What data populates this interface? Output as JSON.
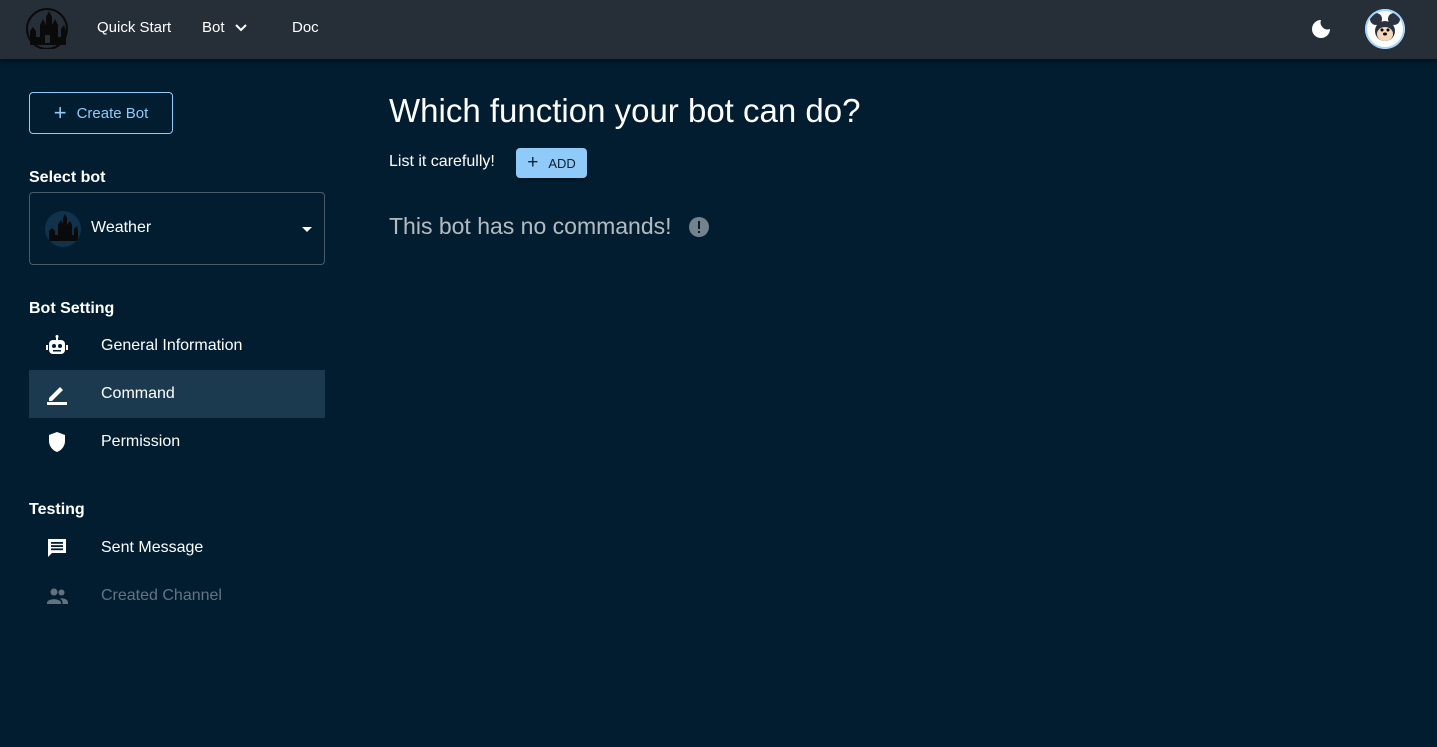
{
  "topbar": {
    "nav": {
      "quick_start": "Quick Start",
      "bot": "Bot",
      "doc": "Doc"
    }
  },
  "sidebar": {
    "create_bot_label": "Create Bot",
    "select_bot_title": "Select bot",
    "selected_bot": "Weather",
    "bot_setting_title": "Bot Setting",
    "bot_setting_items": [
      {
        "label": "General Information",
        "icon": "robot-icon"
      },
      {
        "label": "Command",
        "icon": "pencil-icon",
        "active": true
      },
      {
        "label": "Permission",
        "icon": "shield-icon"
      }
    ],
    "testing_title": "Testing",
    "testing_items": [
      {
        "label": "Sent Message",
        "icon": "message-icon"
      },
      {
        "label": "Created Channel",
        "icon": "people-icon",
        "disabled": true
      }
    ]
  },
  "main": {
    "title": "Which function your bot can do?",
    "subtitle": "List it carefully!",
    "add_label": "ADD",
    "empty_message": "This bot has no commands!"
  },
  "colors": {
    "background": "#021d30",
    "topbar": "#262f38",
    "accent": "#90caf9",
    "active_item": "#1c3a4f"
  }
}
